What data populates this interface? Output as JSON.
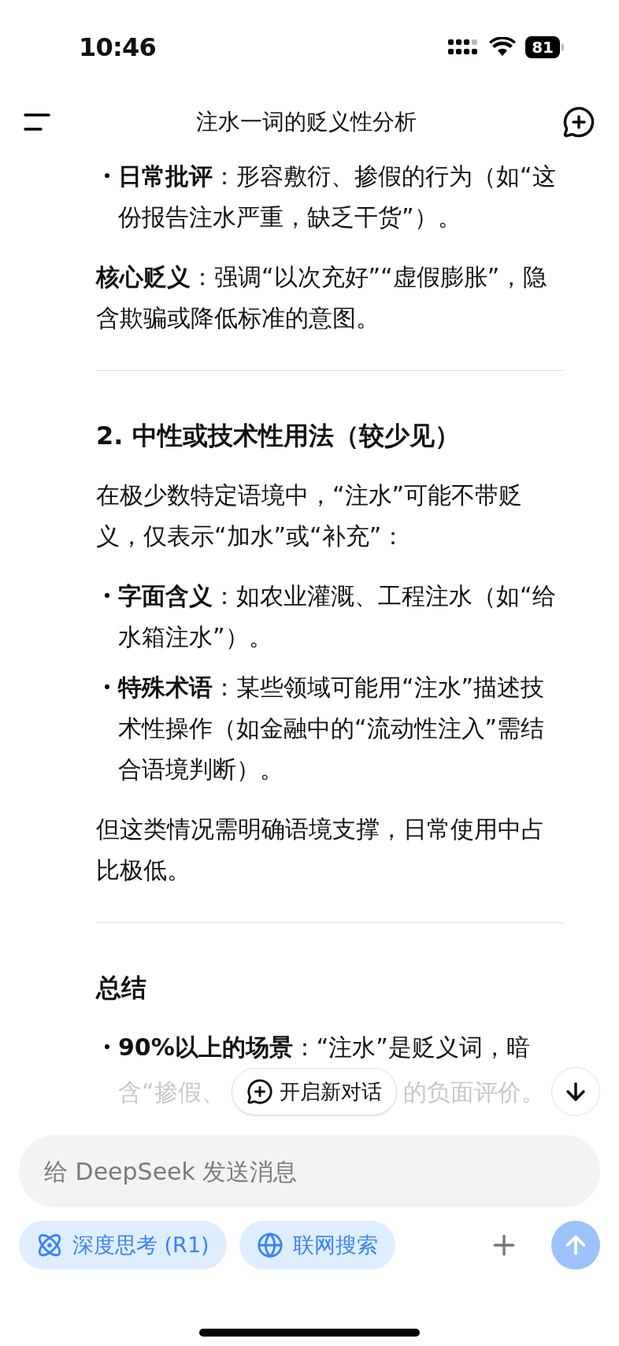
{
  "status_bar": {
    "time": "10:46",
    "battery": "81"
  },
  "header": {
    "title": "注水一词的贬义性分析"
  },
  "content": [
    {
      "kind": "bullets",
      "items": [
        "**日常批评**：形容敷衍、掺假的行为（如“这份报告注水严重，缺乏干货”）。"
      ]
    },
    {
      "kind": "paragraph",
      "text": "**核心贬义**：强调“以次充好”“虚假膨胀”，隐含欺骗或降低标准的意图。"
    },
    {
      "kind": "rule"
    },
    {
      "kind": "heading",
      "text": "2. 中性或技术性用法（较少见）"
    },
    {
      "kind": "paragraph",
      "text": "在极少数特定语境中，“注水”可能不带贬义，仅表示“加水”或“补充”："
    },
    {
      "kind": "bullets",
      "items": [
        "**字面含义**：如农业灌溉、工程注水（如“给水箱注水”）。",
        "**特殊术语**：某些领域可能用“注水”描述技术性操作（如金融中的“流动性注入”需结合语境判断）。"
      ]
    },
    {
      "kind": "paragraph",
      "text": "但这类情况需明确语境支撑，日常使用中占比极低。"
    },
    {
      "kind": "rule"
    },
    {
      "kind": "heading",
      "text": "总结"
    },
    {
      "kind": "bullets",
      "items": [
        "**90%以上的场景**：“注水”是贬义词，暗"
      ]
    }
  ],
  "faded_fragments": [
    "含“掺假、",
    "的负面评价。"
  ],
  "new_chat_button": {
    "label": "开启新对话"
  },
  "composer": {
    "placeholder": "给 DeepSeek 发送消息"
  },
  "toggles": [
    {
      "kind": "atom",
      "label": "深度思考 (R1)",
      "selected": true
    },
    {
      "kind": "globe",
      "label": "联网搜索",
      "selected": true
    }
  ],
  "send_button": {
    "disabled": true
  }
}
